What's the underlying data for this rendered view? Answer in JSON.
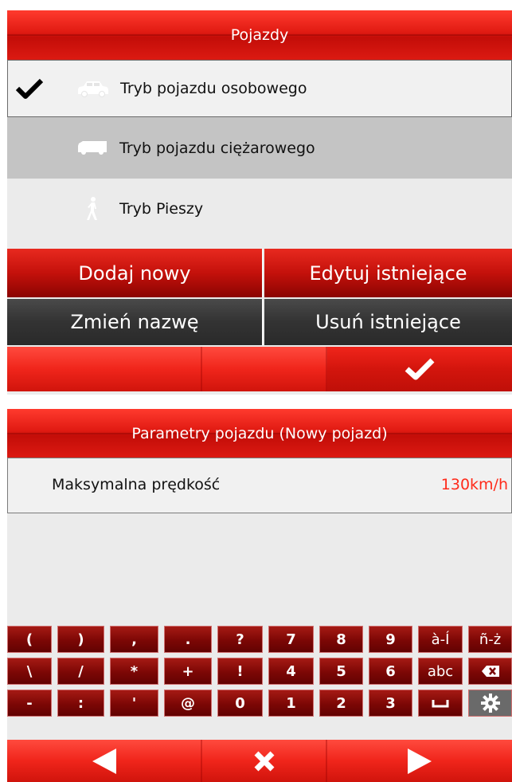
{
  "vehicles_screen": {
    "title": "Pojazdy",
    "modes": [
      {
        "label": "Tryb pojazdu osobowego",
        "icon": "car-icon",
        "selected": true
      },
      {
        "label": "Tryb pojazdu ciężarowego",
        "icon": "truck-icon",
        "selected": false
      },
      {
        "label": "Tryb Pieszy",
        "icon": "pedestrian-icon",
        "selected": false
      }
    ],
    "buttons": {
      "add_new": "Dodaj nowy",
      "edit_existing": "Edytuj istniejące",
      "rename": "Zmień nazwę",
      "delete_existing": "Usuń istniejące"
    },
    "bottom_bar": {
      "confirm_icon": "checkmark-icon"
    }
  },
  "params_screen": {
    "title": "Parametry pojazdu (Nowy pojazd)",
    "param_name": "Maksymalna prędkość",
    "param_value": "130km/h",
    "keyboard_rows": [
      [
        "(",
        ")",
        ",",
        ".",
        "?",
        "7",
        "8",
        "9",
        "à-Í",
        "ñ-ż"
      ],
      [
        "\\",
        "/",
        "*",
        "+",
        "!",
        "4",
        "5",
        "6",
        "abc",
        "⌫"
      ],
      [
        "-",
        ":",
        "'",
        "@",
        "0",
        "1",
        "2",
        "3",
        "␣",
        "⚙"
      ]
    ],
    "bottom_bar": {
      "prev_icon": "arrow-left-icon",
      "cancel_icon": "close-icon",
      "next_icon": "arrow-right-icon"
    }
  },
  "colors": {
    "accent_red": "#e01a12",
    "value_red": "#ff2a1a"
  }
}
